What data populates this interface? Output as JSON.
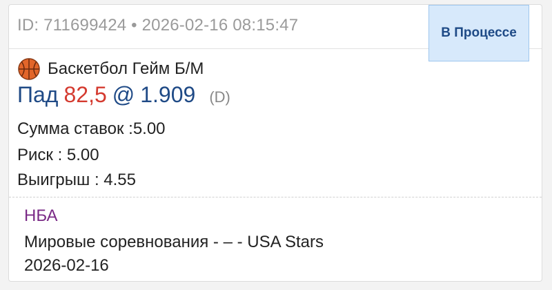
{
  "ticket": {
    "id_line": "ID: 711699424 • 2026-02-16 08:15:47",
    "status": "В Процессе"
  },
  "sport": {
    "icon": "basketball-icon",
    "label": "Баскетбол Гейм Б/М"
  },
  "pick": {
    "side": "Пад",
    "line": "82,5",
    "at": "@",
    "odds": "1.909",
    "format": "(D)"
  },
  "amounts": {
    "stake": "Сумма ставок :5.00",
    "risk": "Риск : 5.00",
    "win": "Выигрыш : 4.55"
  },
  "event": {
    "league": "НБА",
    "name": "Мировые соревнования - – - USA Stars",
    "date": "2026-02-16"
  },
  "colors": {
    "status_bg": "#d7e9fb",
    "status_text": "#1e4a86",
    "pick_text": "#1f4a86",
    "line_text": "#d43a2f",
    "league_text": "#7a2a86"
  }
}
